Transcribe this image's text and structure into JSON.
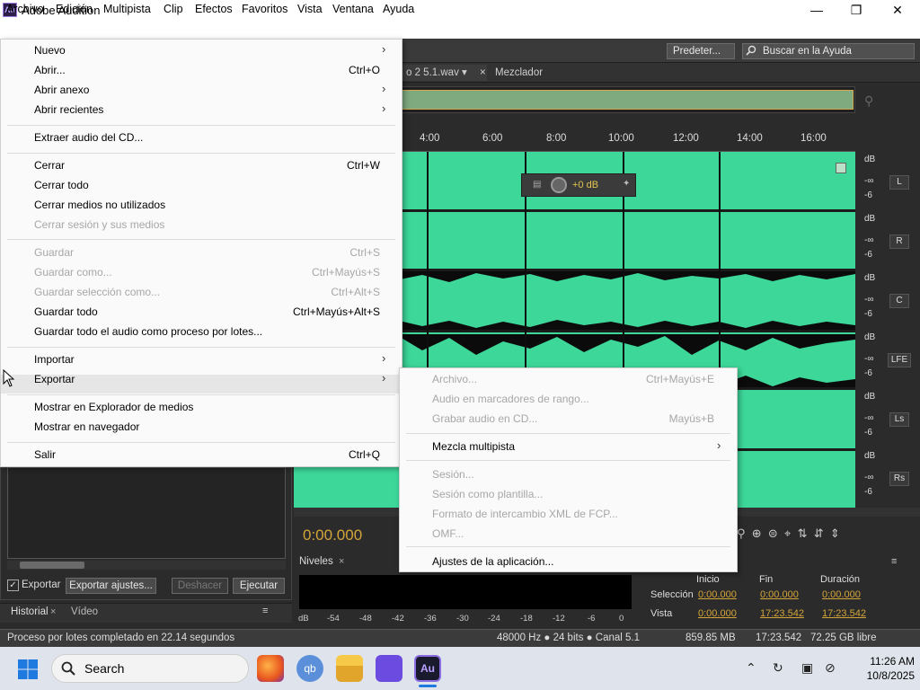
{
  "window": {
    "title": "Adobe Audition",
    "icon_text": "Au",
    "min_label": "—",
    "max_label": "❐",
    "close_label": "✕"
  },
  "menubar": [
    "Archivo",
    "Edición",
    "Multipista",
    "Clip",
    "Efectos",
    "Favoritos",
    "Vista",
    "Ventana",
    "Ayuda"
  ],
  "toolbar": {
    "workspace": "Predeter...",
    "search_placeholder": "Buscar en la Ayuda"
  },
  "editor": {
    "file_tab": "o 2 5.1.wav",
    "mixer_tab": "Mezclador",
    "ruler_ticks": [
      "4:00",
      "6:00",
      "8:00",
      "10:00",
      "12:00",
      "14:00",
      "16:00"
    ],
    "hud_value": "+0 dB",
    "timecode": "0:00.000",
    "db_label": "dB",
    "db_inf": "-∞",
    "db_6": "-6",
    "channels": [
      "L",
      "R",
      "C",
      "LFE",
      "Ls",
      "Rs"
    ]
  },
  "batch_panel": {
    "export_checkbox": "Exportar",
    "export_settings_btn": "Exportar ajustes...",
    "undo_btn": "Deshacer",
    "run_btn": "Ejecutar"
  },
  "history_tabs": [
    "Historial",
    "Vídeo"
  ],
  "levels": {
    "tab": "Niveles",
    "scale": [
      "dB",
      "-54",
      "-48",
      "-42",
      "-36",
      "-30",
      "-24",
      "-18",
      "-12",
      "-6",
      "0"
    ]
  },
  "selection_view": {
    "headers": [
      "Inicio",
      "Fin",
      "Duración"
    ],
    "rows": [
      {
        "label": "Selección",
        "values": [
          "0:00.000",
          "0:00.000",
          "0:00.000"
        ]
      },
      {
        "label": "Vista",
        "values": [
          "0:00.000",
          "17:23.542",
          "17:23.542"
        ]
      }
    ]
  },
  "statusbar": {
    "message": "Proceso por lotes completado en 22.14 segundos",
    "format": "48000 Hz ● 24 bits ● Canal 5.1",
    "size": "859.85 MB",
    "duration": "17:23.542",
    "free": "72.25 GB libre"
  },
  "file_menu": [
    {
      "label": "Nuevo",
      "submenu": true
    },
    {
      "label": "Abrir...",
      "shortcut": "Ctrl+O"
    },
    {
      "label": "Abrir anexo",
      "submenu": true
    },
    {
      "label": "Abrir recientes",
      "submenu": true
    },
    {
      "sep": true
    },
    {
      "label": "Extraer audio del CD..."
    },
    {
      "sep": true
    },
    {
      "label": "Cerrar",
      "shortcut": "Ctrl+W"
    },
    {
      "label": "Cerrar todo"
    },
    {
      "label": "Cerrar medios no utilizados"
    },
    {
      "label": "Cerrar sesión y sus medios",
      "disabled": true
    },
    {
      "sep": true
    },
    {
      "label": "Guardar",
      "shortcut": "Ctrl+S",
      "disabled": true
    },
    {
      "label": "Guardar como...",
      "shortcut": "Ctrl+Mayús+S",
      "disabled": true
    },
    {
      "label": "Guardar selección como...",
      "shortcut": "Ctrl+Alt+S",
      "disabled": true
    },
    {
      "label": "Guardar todo",
      "shortcut": "Ctrl+Mayús+Alt+S"
    },
    {
      "label": "Guardar todo el audio como proceso por lotes..."
    },
    {
      "sep": true
    },
    {
      "label": "Importar",
      "submenu": true
    },
    {
      "label": "Exportar",
      "submenu": true,
      "active": true
    },
    {
      "sep": true
    },
    {
      "label": "Mostrar en Explorador de medios"
    },
    {
      "label": "Mostrar en navegador"
    },
    {
      "sep": true
    },
    {
      "label": "Salir",
      "shortcut": "Ctrl+Q"
    }
  ],
  "export_menu": [
    {
      "label": "Archivo...",
      "shortcut": "Ctrl+Mayús+E",
      "disabled": true
    },
    {
      "label": "Audio en marcadores de rango...",
      "disabled": true
    },
    {
      "label": "Grabar audio en CD...",
      "shortcut": "Mayús+B",
      "disabled": true
    },
    {
      "sep": true
    },
    {
      "label": "Mezcla multipista",
      "submenu": true
    },
    {
      "sep": true
    },
    {
      "label": "Sesión...",
      "disabled": true
    },
    {
      "label": "Sesión como plantilla...",
      "disabled": true
    },
    {
      "label": "Formato de intercambio XML de FCP...",
      "disabled": true
    },
    {
      "label": "OMF...",
      "disabled": true
    },
    {
      "sep": true
    },
    {
      "label": "Ajustes de la aplicación..."
    }
  ],
  "taskbar": {
    "search": "Search",
    "time": "11:26 AM",
    "date": "10/8/2025"
  },
  "colors": {
    "waveform": "#3dd79a",
    "timecode": "#d4a53a",
    "panel": "#2b2b2b"
  }
}
